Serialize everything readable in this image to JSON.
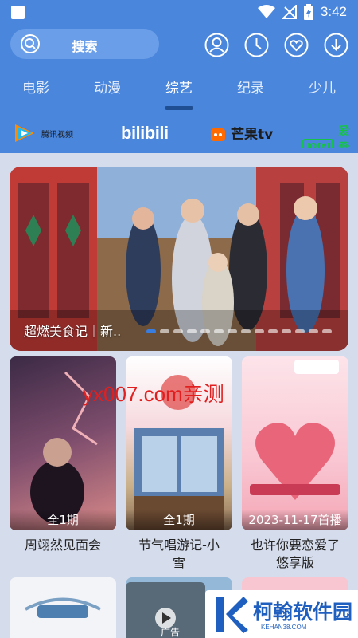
{
  "status": {
    "time": "3:42"
  },
  "search": {
    "label": "搜索"
  },
  "tabs": [
    "电影",
    "动漫",
    "综艺",
    "纪录",
    "少儿"
  ],
  "active_tab": "综艺",
  "platforms": {
    "tencent": "腾讯视频",
    "bilibili": "bilibili",
    "mango": "芒果tv",
    "iqiyi_box": "iQIYI",
    "iqiyi_text": "爱奇艺"
  },
  "banner": {
    "caption": "超燃美食记｜新..",
    "dot_count": 14,
    "active_dot": 0
  },
  "cards": [
    {
      "badge": "全1期",
      "title": "周翊然见面会",
      "title2": ""
    },
    {
      "badge": "全1期",
      "title": "节气唱游记-小",
      "title2": "雪"
    },
    {
      "badge": "2023-11-17首播",
      "title": "也许你要恋爱了",
      "title2": "悠享版"
    }
  ],
  "overlay": {
    "watermark": "yx007.com亲测",
    "ad_main": "柯翰软件园",
    "ad_sub": "KEHAN38.COM",
    "ad_tag": "广告"
  },
  "colors": {
    "header": "#4a86dc",
    "accent": "#1f4e92",
    "background": "#d5dcec"
  }
}
